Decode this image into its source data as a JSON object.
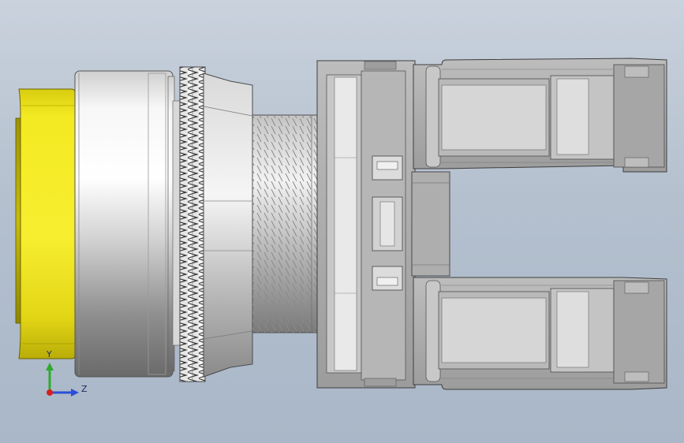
{
  "axis_triad": {
    "y_label": "Y",
    "z_label": "Z"
  },
  "colors": {
    "button_cap": "#f2e61a",
    "metal_light": "#f4f4f4",
    "metal_dark": "#6e6e6e",
    "housing": "#a4a4a4",
    "axis_y": "#2eaa2e",
    "axis_z": "#2c4fd8",
    "axis_origin": "#d42020"
  }
}
